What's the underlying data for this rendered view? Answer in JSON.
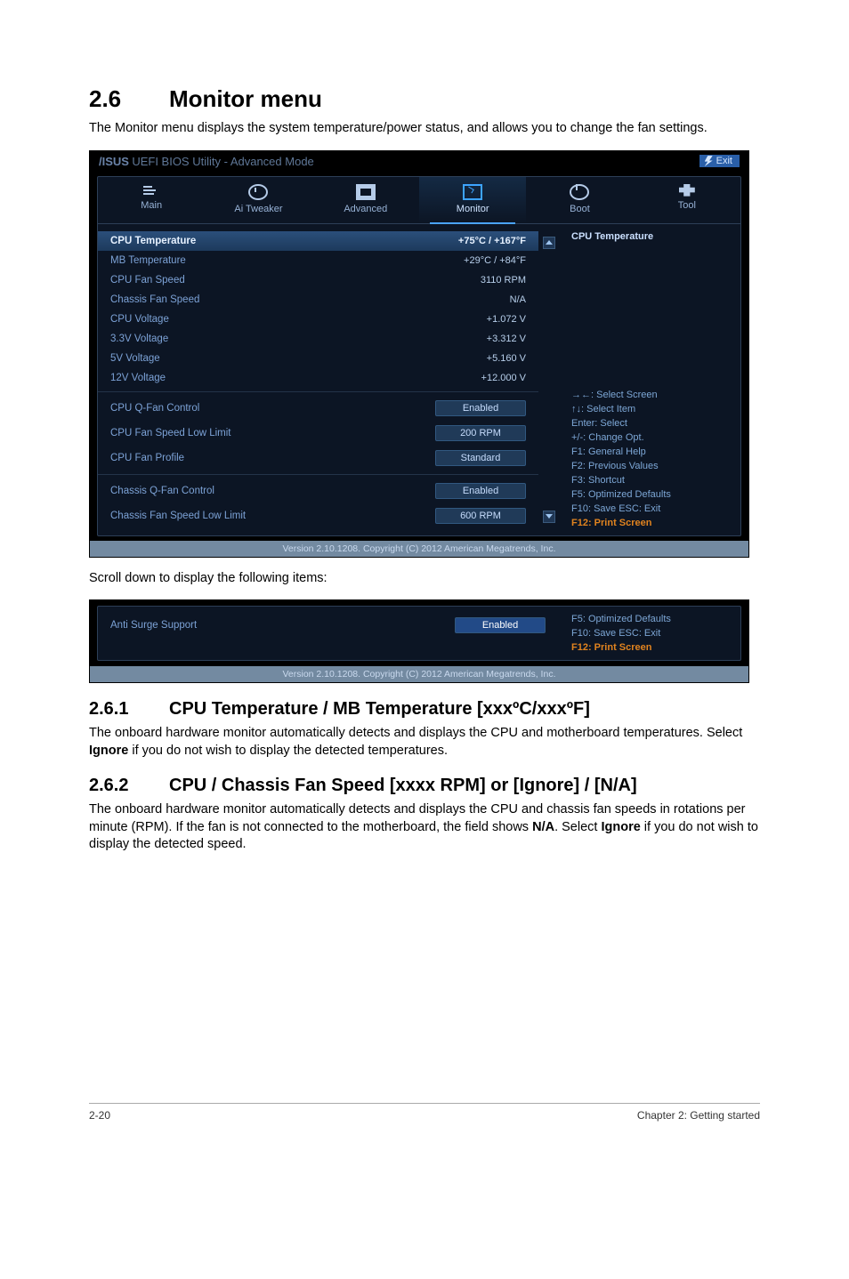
{
  "heading": {
    "num": "2.6",
    "title": "Monitor menu"
  },
  "intro": "The Monitor menu displays the system temperature/power status, and allows you to change the fan settings.",
  "bios1": {
    "brand": "/ISUS",
    "title": "UEFI BIOS Utility - Advanced Mode",
    "exit": "Exit",
    "tabs": {
      "main": "Main",
      "tweaker": "Ai Tweaker",
      "advanced": "Advanced",
      "monitor": "Monitor",
      "boot": "Boot",
      "tool": "Tool"
    },
    "rows": {
      "cpu_temp": {
        "l": "CPU Temperature",
        "v": "+75°C / +167°F"
      },
      "mb_temp": {
        "l": "MB Temperature",
        "v": "+29°C / +84°F"
      },
      "cpu_fan": {
        "l": "CPU Fan Speed",
        "v": "3110 RPM"
      },
      "cha_fan": {
        "l": "Chassis Fan  Speed",
        "v": "N/A"
      },
      "cpu_v": {
        "l": "CPU Voltage",
        "v": "+1.072 V"
      },
      "v33": {
        "l": "3.3V Voltage",
        "v": "+3.312 V"
      },
      "v5": {
        "l": "5V Voltage",
        "v": "+5.160 V"
      },
      "v12": {
        "l": "12V Voltage",
        "v": "+12.000 V"
      },
      "qfan_ctrl": {
        "l": "CPU Q-Fan Control",
        "v": "Enabled"
      },
      "qfan_low": {
        "l": "CPU Fan Speed Low Limit",
        "v": "200 RPM"
      },
      "qfan_prof": {
        "l": "CPU Fan Profile",
        "v": "Standard"
      },
      "chaq_ctrl": {
        "l": "Chassis Q-Fan Control",
        "v": "Enabled"
      },
      "chaq_low": {
        "l": "Chassis Fan Speed Low Limit",
        "v": "600 RPM"
      }
    },
    "rpanel": {
      "t1": "CPU Temperature",
      "h1": "→←: Select Screen",
      "h2": "↑↓: Select Item",
      "h3": "Enter: Select",
      "h4": "+/-: Change Opt.",
      "h5": "F1: General Help",
      "h6": "F2: Previous Values",
      "h7": "F3: Shortcut",
      "h8": "F5: Optimized Defaults",
      "h9": "F10: Save   ESC: Exit",
      "h10": "F12: Print Screen"
    },
    "footer": "Version 2.10.1208. Copyright (C) 2012 American Megatrends, Inc."
  },
  "scroll_note": "Scroll down to display the following items:",
  "bios2": {
    "row": {
      "l": "Anti Surge Support",
      "v": "Enabled"
    },
    "rpanel": {
      "h1": "F5: Optimized Defaults",
      "h2": "F10: Save   ESC: Exit",
      "h3": "F12: Print Screen"
    },
    "footer": "Version 2.10.1208. Copyright (C) 2012 American Megatrends, Inc."
  },
  "sub1": {
    "num": "2.6.1",
    "title": "CPU Temperature / MB Temperature [xxxºC/xxxºF]"
  },
  "sub1_body": "The onboard hardware monitor automatically detects and displays the CPU and motherboard temperatures. Select Ignore if you do not wish to display the detected temperatures.",
  "sub2": {
    "num": "2.6.2",
    "title": "CPU / Chassis Fan Speed [xxxx RPM] or [Ignore] / [N/A]"
  },
  "sub2_body": "The onboard hardware monitor automatically detects and displays the CPU and chassis fan speeds in rotations per minute (RPM). If the fan is not connected to the motherboard, the field shows N/A. Select Ignore if you do not wish to display the detected speed.",
  "page_footer": {
    "left": "2-20",
    "right": "Chapter 2: Getting started"
  }
}
